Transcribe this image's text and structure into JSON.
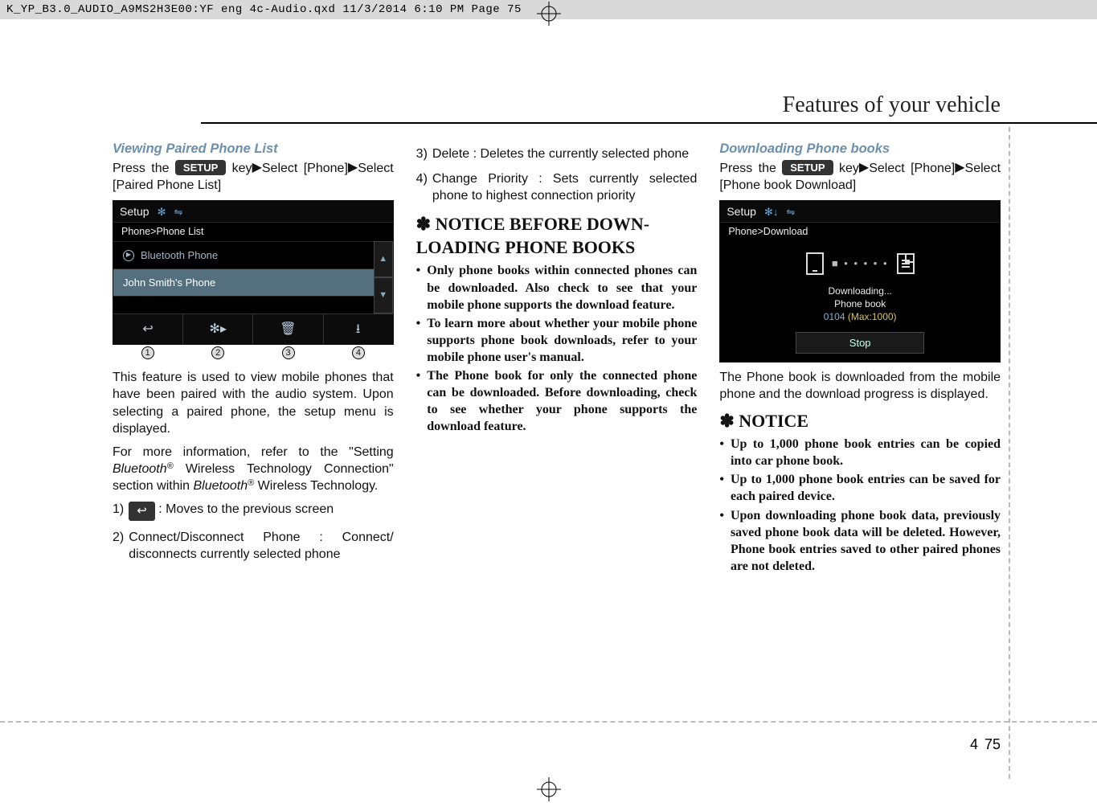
{
  "topbar": "K_YP_B3.0_AUDIO_A9MS2H3E00:YF eng 4c-Audio.qxd  11/3/2014  6:10 PM  Page 75",
  "section_title": "Features of your vehicle",
  "page_number": {
    "chapter": "4",
    "page": "75"
  },
  "col1": {
    "heading": "Viewing Paired Phone List",
    "intro_pre": "Press the ",
    "setup_key": "SETUP",
    "intro_mid": " key",
    "triangle": "▶",
    "intro_post1": "Select [Phone]",
    "intro_post2": "Select [Paired Phone List]",
    "shot": {
      "title": "Setup",
      "bt_icon": "✻",
      "car_icon": "⇋",
      "crumb": "Phone>Phone List",
      "row1": "Bluetooth Phone",
      "row2": "John Smith's Phone",
      "footer_icons": {
        "back": "↩",
        "bt": "✻▸",
        "trash": "🗑",
        "down": "⭳"
      },
      "circ_labels": [
        "1",
        "2",
        "3",
        "4"
      ]
    },
    "para1": "This feature is used to view mobile phones that have been paired with the audio system. Upon selecting a paired phone, the setup menu is displayed.",
    "para2_pre": "For more information, refer to the \"Setting ",
    "bluetooth": "Bluetooth",
    "reg": "®",
    "para2_mid": " Wireless Technology Connection\" section within ",
    "para2_post": " Wireless Technology.",
    "list": [
      {
        "n": "1)",
        "text_pre": "",
        "icon": true,
        "text_post": " : Moves to the previous screen"
      },
      {
        "n": "2)",
        "text_pre": "Connect/Disconnect Phone : Connect/ disconnects currently selected phone",
        "icon": false,
        "text_post": ""
      }
    ]
  },
  "col2": {
    "list_cont": [
      {
        "n": "3)",
        "text": "Delete : Deletes the currently selected phone"
      },
      {
        "n": "4)",
        "text": "Change Priority : Sets currently selected phone to highest connection priority"
      }
    ],
    "notice_title_star": "✽",
    "notice_title": "NOTICE BEFORE DOWN-LOADING PHONE BOOKS",
    "bullets": [
      "Only phone books within connected phones can be downloaded. Also check to see that your mobile phone supports the download feature.",
      "To learn more about whether your mobile phone supports phone book downloads, refer to your mobile phone user's manual.",
      "The Phone book for only the connected phone can be downloaded. Before downloading, check to see whether your phone supports the download feature."
    ]
  },
  "col3": {
    "heading": "Downloading Phone books",
    "intro_pre": "Press the ",
    "setup_key": "SETUP",
    "intro_mid": " key",
    "triangle": "▶",
    "intro_seg1": "Select [Phone]",
    "intro_seg2": "Select [Phone book Download]",
    "shot": {
      "title": "Setup",
      "bt_icon": "✻↓",
      "car_icon": "⇋",
      "crumb": "Phone>Download",
      "dl_line1": "Downloading...",
      "dl_line2": "Phone book",
      "dl_prog": "0104",
      "dl_max": "(Max:1000)",
      "stop": "Stop"
    },
    "para1": "The Phone book is downloaded from the mobile phone and the download progress is displayed.",
    "notice_title_star": "✽",
    "notice_title": "NOTICE",
    "bullets": [
      "Up to 1,000 phone book entries can be copied into car phone book.",
      "Up to 1,000 phone book entries can be saved for each paired device.",
      "Upon downloading phone book data, previously saved phone book data will be deleted. However, Phone book entries saved to other paired phones are not deleted."
    ]
  }
}
